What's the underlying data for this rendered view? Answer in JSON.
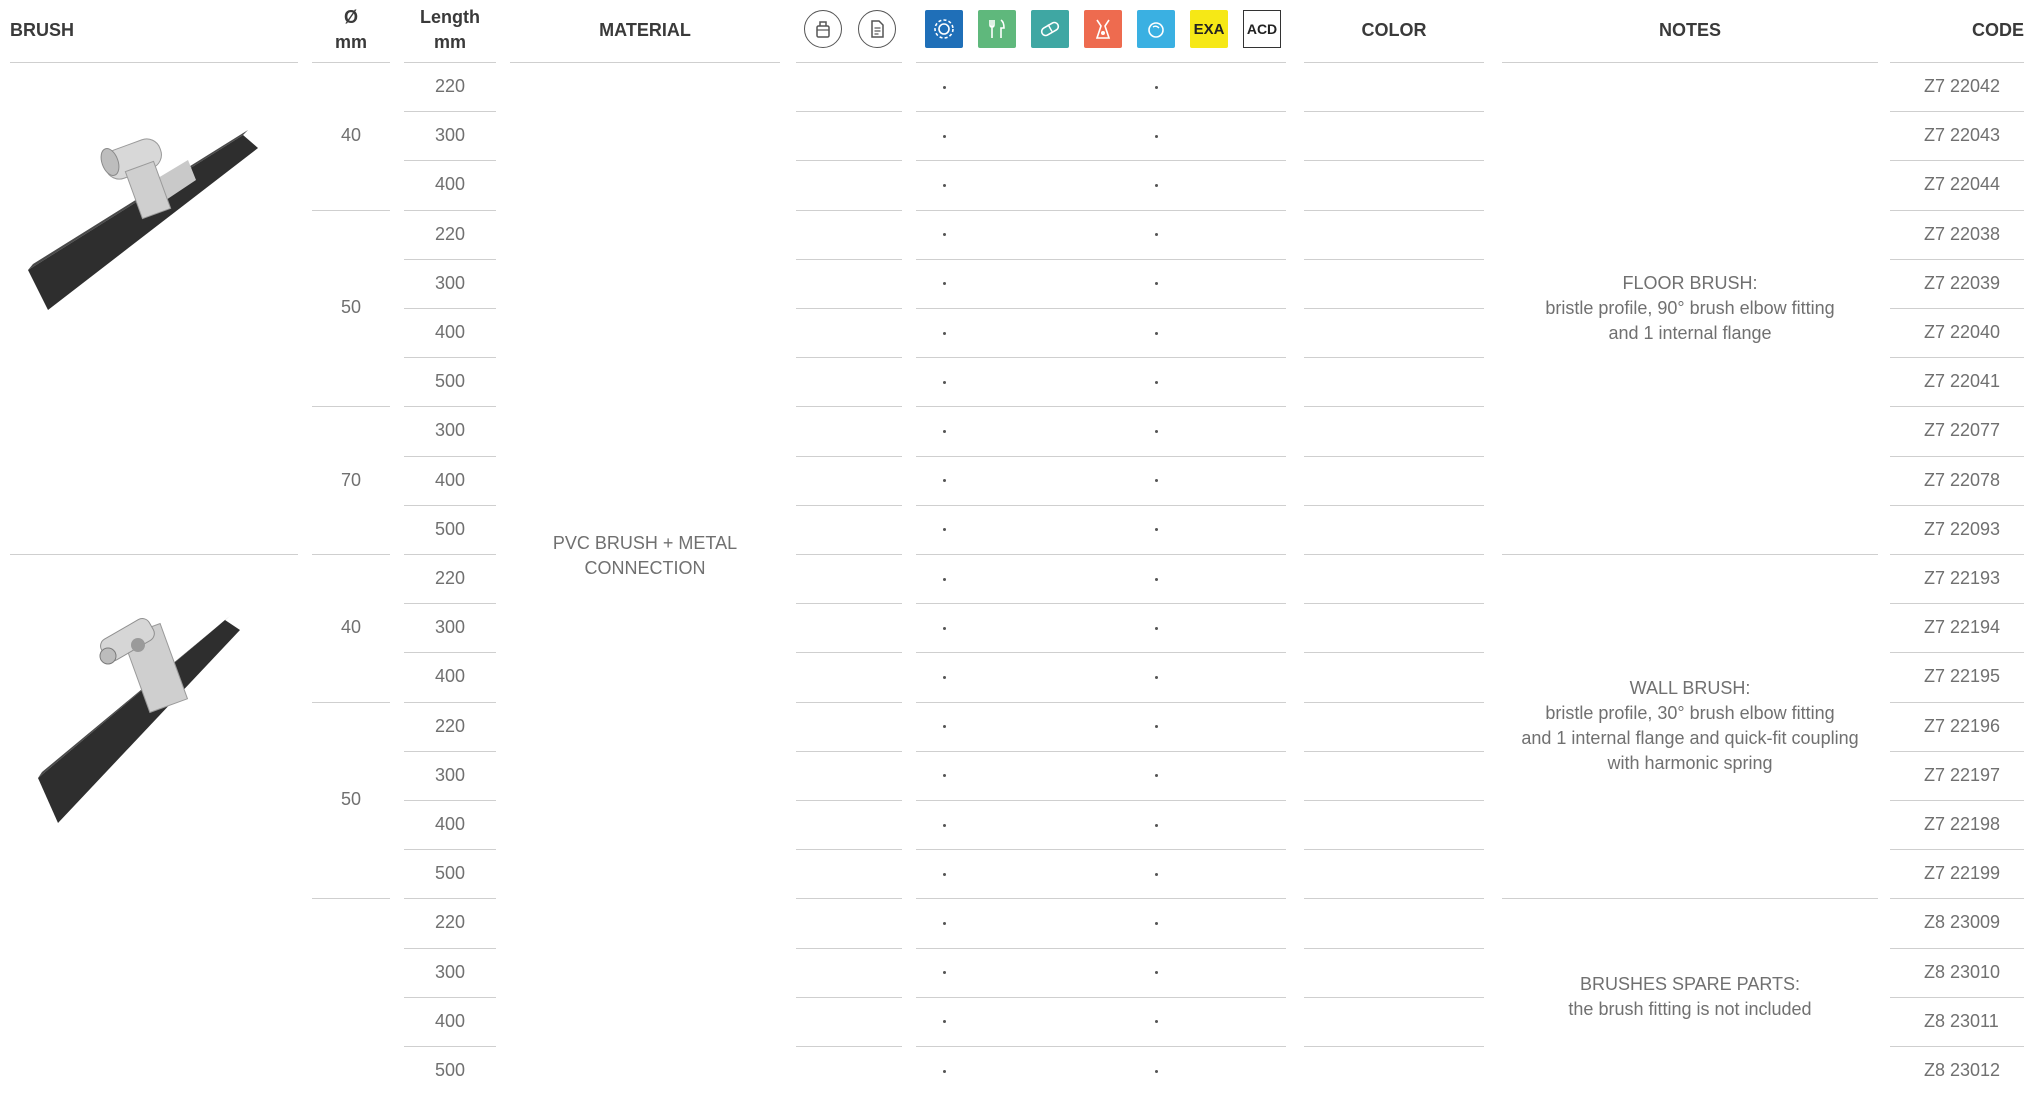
{
  "headers": {
    "brush": "BRUSH",
    "diameter_symbol": "Ø",
    "diameter_unit": "mm",
    "length": "Length",
    "length_unit": "mm",
    "material": "MATERIAL",
    "color": "COLOR",
    "notes": "NOTES",
    "code": "CODE"
  },
  "icons": [
    {
      "name": "container-icon",
      "style": "circle"
    },
    {
      "name": "document-icon",
      "style": "circle"
    },
    {
      "name": "gear-icon",
      "style": "square",
      "color": "#1f6fb8"
    },
    {
      "name": "food-icon",
      "style": "square",
      "color": "#5fb87c"
    },
    {
      "name": "pill-icon",
      "style": "square",
      "color": "#3fa7a3"
    },
    {
      "name": "chemical-icon",
      "style": "square",
      "color": "#ee6b4f"
    },
    {
      "name": "water-icon",
      "style": "square",
      "color": "#3ab0e2"
    },
    {
      "name": "exa-icon",
      "style": "square",
      "color": "#f6e816",
      "text": "EXA"
    },
    {
      "name": "acd-icon",
      "style": "outline",
      "text": "ACD"
    }
  ],
  "material": [
    "PVC BRUSH + METAL",
    "CONNECTION"
  ],
  "diameter_groups": [
    {
      "value": "40",
      "rows": 3
    },
    {
      "value": "50",
      "rows": 4
    },
    {
      "value": "70",
      "rows": 3
    },
    {
      "value": "40",
      "rows": 3
    },
    {
      "value": "50",
      "rows": 4
    },
    {
      "value": "",
      "rows": 4
    }
  ],
  "notes": [
    {
      "rows": 10,
      "lines": [
        "FLOOR BRUSH:",
        "bristle profile, 90° brush elbow fitting",
        "and 1 internal flange"
      ]
    },
    {
      "rows": 7,
      "lines": [
        "WALL BRUSH:",
        "bristle profile, 30° brush elbow fitting",
        "and 1 internal flange and quick-fit coupling",
        "with harmonic spring"
      ]
    },
    {
      "rows": 4,
      "lines": [
        "BRUSHES SPARE PARTS:",
        "the brush fitting is not included"
      ]
    }
  ],
  "rows": [
    {
      "length": "220",
      "code": "Z7 22042"
    },
    {
      "length": "300",
      "code": "Z7 22043"
    },
    {
      "length": "400",
      "code": "Z7 22044"
    },
    {
      "length": "220",
      "code": "Z7 22038"
    },
    {
      "length": "300",
      "code": "Z7 22039"
    },
    {
      "length": "400",
      "code": "Z7 22040"
    },
    {
      "length": "500",
      "code": "Z7 22041"
    },
    {
      "length": "300",
      "code": "Z7 22077"
    },
    {
      "length": "400",
      "code": "Z7 22078"
    },
    {
      "length": "500",
      "code": "Z7 22093"
    },
    {
      "length": "220",
      "code": "Z7 22193"
    },
    {
      "length": "300",
      "code": "Z7 22194"
    },
    {
      "length": "400",
      "code": "Z7 22195"
    },
    {
      "length": "220",
      "code": "Z7 22196"
    },
    {
      "length": "300",
      "code": "Z7 22197"
    },
    {
      "length": "400",
      "code": "Z7 22198"
    },
    {
      "length": "500",
      "code": "Z7 22199"
    },
    {
      "length": "220",
      "code": "Z8 23009"
    },
    {
      "length": "300",
      "code": "Z8 23010"
    },
    {
      "length": "400",
      "code": "Z8 23011"
    },
    {
      "length": "500",
      "code": "Z8 23012"
    }
  ]
}
